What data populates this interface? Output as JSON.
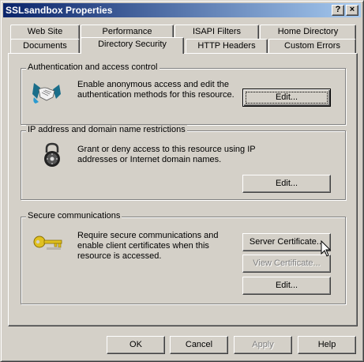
{
  "window": {
    "title": "SSLsandbox Properties",
    "help_button": "?",
    "close_button": "×"
  },
  "tabs": {
    "row_back": [
      "Web Site",
      "Performance",
      "ISAPI Filters",
      "Home Directory"
    ],
    "row_front": [
      "Documents",
      "Directory Security",
      "HTTP Headers",
      "Custom Errors"
    ],
    "active": "Directory Security"
  },
  "groups": {
    "auth": {
      "title": "Authentication and access control",
      "description": "Enable anonymous access and edit the authentication methods for this resource.",
      "edit_label": "Edit..."
    },
    "ip": {
      "title": "IP address and domain name restrictions",
      "description": "Grant or deny access to this resource using IP addresses or Internet domain names.",
      "edit_label": "Edit..."
    },
    "secure": {
      "title": "Secure communications",
      "description": "Require secure communications and enable client certificates when this resource is accessed.",
      "server_cert_label": "Server Certificate...",
      "view_cert_label": "View Certificate...",
      "edit_label": "Edit..."
    }
  },
  "footer": {
    "ok_label": "OK",
    "cancel_label": "Cancel",
    "apply_label": "Apply",
    "help_label": "Help"
  }
}
